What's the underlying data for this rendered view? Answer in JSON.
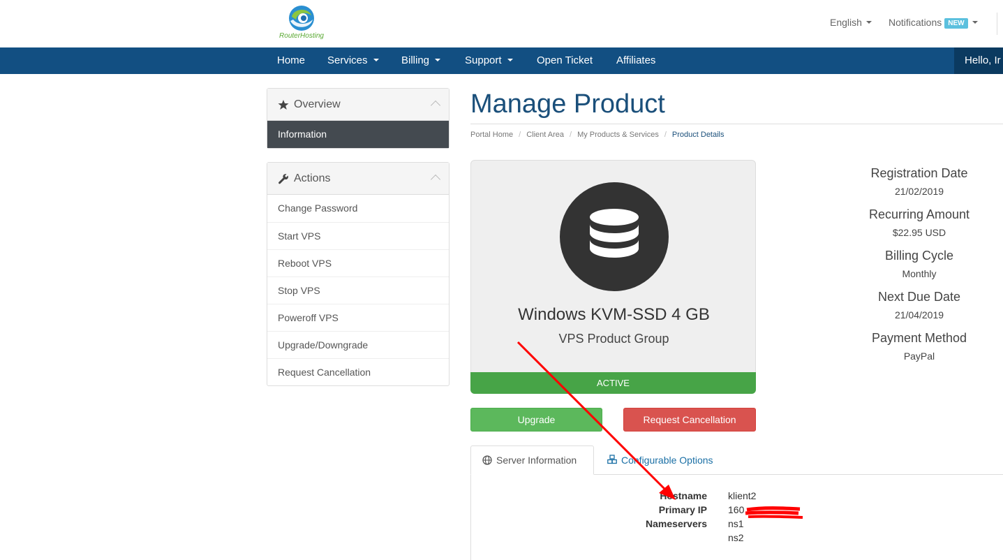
{
  "header": {
    "logo_text": "RouterHosting",
    "language": "English",
    "notifications": "Notifications",
    "notifications_badge": "NEW"
  },
  "nav": {
    "items": [
      {
        "label": "Home",
        "dropdown": false
      },
      {
        "label": "Services",
        "dropdown": true
      },
      {
        "label": "Billing",
        "dropdown": true
      },
      {
        "label": "Support",
        "dropdown": true
      },
      {
        "label": "Open Ticket",
        "dropdown": false
      },
      {
        "label": "Affiliates",
        "dropdown": false
      }
    ],
    "greeting": "Hello, Ir"
  },
  "sidebar": {
    "overview": {
      "title": "Overview",
      "icon": "star-icon",
      "items": [
        {
          "label": "Information",
          "active": true
        }
      ]
    },
    "actions": {
      "title": "Actions",
      "icon": "wrench-icon",
      "items": [
        {
          "label": "Change Password"
        },
        {
          "label": "Start VPS"
        },
        {
          "label": "Reboot VPS"
        },
        {
          "label": "Stop VPS"
        },
        {
          "label": "Poweroff VPS"
        },
        {
          "label": "Upgrade/Downgrade"
        },
        {
          "label": "Request Cancellation"
        }
      ]
    }
  },
  "main": {
    "title": "Manage Product",
    "breadcrumb": [
      "Portal Home",
      "Client Area",
      "My Products & Services",
      "Product Details"
    ],
    "product": {
      "icon": "database-icon",
      "name": "Windows KVM-SSD 4 GB",
      "group": "VPS Product Group",
      "status": "ACTIVE"
    },
    "buttons": {
      "upgrade": "Upgrade",
      "cancel": "Request Cancellation"
    },
    "details": [
      {
        "label": "Registration Date",
        "value": "21/02/2019"
      },
      {
        "label": "Recurring Amount",
        "value": "$22.95 USD"
      },
      {
        "label": "Billing Cycle",
        "value": "Monthly"
      },
      {
        "label": "Next Due Date",
        "value": "21/04/2019"
      },
      {
        "label": "Payment Method",
        "value": "PayPal"
      }
    ],
    "tabs": [
      {
        "label": "Server Information",
        "icon": "globe-icon",
        "active": true
      },
      {
        "label": "Configurable Options",
        "icon": "cubes-icon",
        "active": false
      }
    ],
    "server_info": {
      "hostname_label": "Hostname",
      "hostname": "klient2",
      "ip_label": "Primary IP",
      "ip_visible": "160",
      "ns_label": "Nameservers",
      "ns1": "ns1",
      "ns2": "ns2"
    }
  },
  "colors": {
    "navbar": "#124f82",
    "title": "#1a4f7a",
    "active_status": "#47a447",
    "upgrade_button": "#5cb85c",
    "cancel_button": "#d9534f",
    "annotation": "#ff0000"
  }
}
